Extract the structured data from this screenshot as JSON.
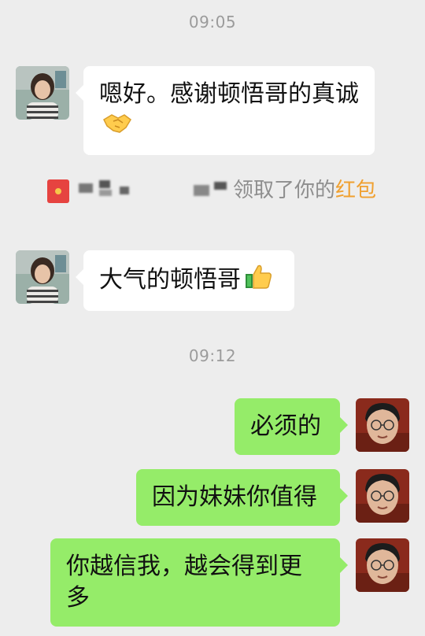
{
  "timestamps": [
    "09:05",
    "09:12"
  ],
  "messages": [
    {
      "side": "in",
      "text": "嗯好。感谢顿悟哥的真诚",
      "emoji": "handshake"
    },
    {
      "side": "in",
      "text": "大气的顿悟哥",
      "emoji": "thumbs-up"
    },
    {
      "side": "out",
      "text": "必须的"
    },
    {
      "side": "out",
      "text": "因为妹妹你值得"
    },
    {
      "side": "out",
      "text": "你越信我，越会得到更多"
    }
  ],
  "system_notice": {
    "blurred_prefix": "领取了你的",
    "highlight": "红包"
  },
  "colors": {
    "background": "#ededed",
    "incoming_bubble": "#ffffff",
    "outgoing_bubble": "#95ec69",
    "notice_text": "#8e8e8e",
    "red_packet_link": "#f0a02f"
  }
}
